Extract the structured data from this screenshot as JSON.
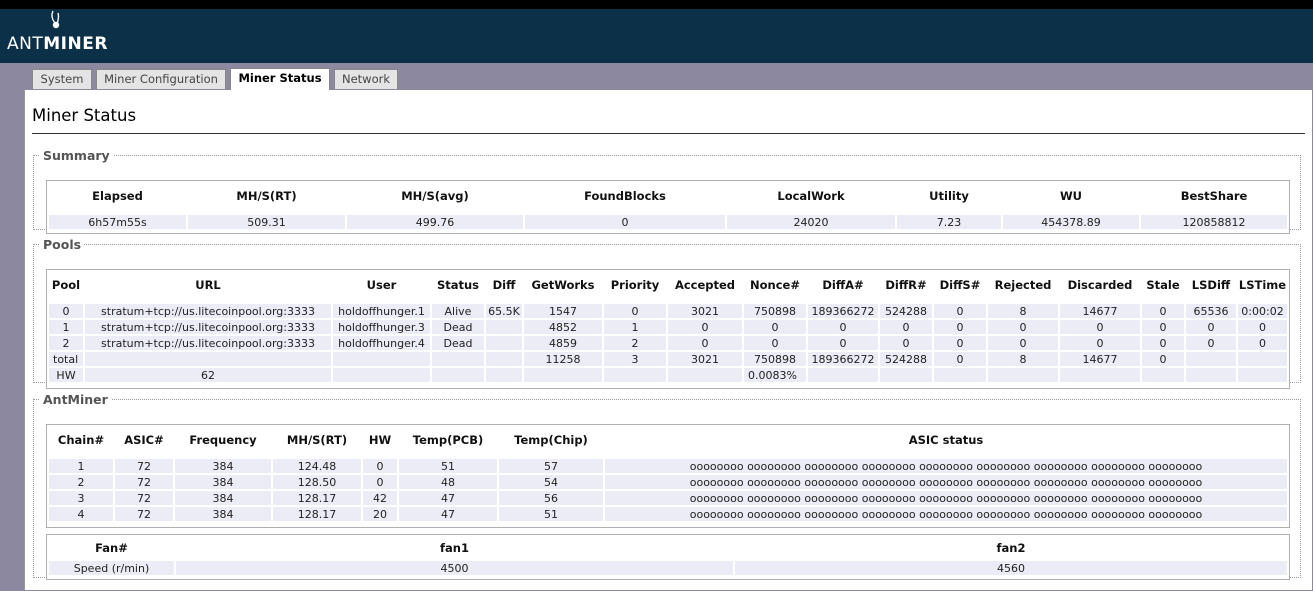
{
  "brand": {
    "prefix": "ANT",
    "suffix": "MINER"
  },
  "tabs": [
    {
      "label": "System"
    },
    {
      "label": "Miner Configuration"
    },
    {
      "label": "Miner Status"
    },
    {
      "label": "Network"
    }
  ],
  "page_title": "Miner Status",
  "summary": {
    "legend": "Summary",
    "headers": [
      "Elapsed",
      "MH/S(RT)",
      "MH/S(avg)",
      "FoundBlocks",
      "LocalWork",
      "Utility",
      "WU",
      "BestShare"
    ],
    "row": [
      "6h57m55s",
      "509.31",
      "499.76",
      "0",
      "24020",
      "7.23",
      "454378.89",
      "120858812"
    ]
  },
  "pools": {
    "legend": "Pools",
    "headers": [
      "Pool",
      "URL",
      "User",
      "Status",
      "Diff",
      "GetWorks",
      "Priority",
      "Accepted",
      "Nonce#",
      "DiffA#",
      "DiffR#",
      "DiffS#",
      "Rejected",
      "Discarded",
      "Stale",
      "LSDiff",
      "LSTime"
    ],
    "rows": [
      [
        "0",
        "stratum+tcp://us.litecoinpool.org:3333",
        "holdoffhunger.1",
        "Alive",
        "65.5K",
        "1547",
        "0",
        "3021",
        "750898",
        "189366272",
        "524288",
        "0",
        "8",
        "14677",
        "0",
        "65536",
        "0:00:02"
      ],
      [
        "1",
        "stratum+tcp://us.litecoinpool.org:3333",
        "holdoffhunger.3",
        "Dead",
        "",
        "4852",
        "1",
        "0",
        "0",
        "0",
        "0",
        "0",
        "0",
        "0",
        "0",
        "0",
        "0"
      ],
      [
        "2",
        "stratum+tcp://us.litecoinpool.org:3333",
        "holdoffhunger.4",
        "Dead",
        "",
        "4859",
        "2",
        "0",
        "0",
        "0",
        "0",
        "0",
        "0",
        "0",
        "0",
        "0",
        "0"
      ],
      [
        "total",
        "",
        "",
        "",
        "",
        "11258",
        "3",
        "3021",
        "750898",
        "189366272",
        "524288",
        "0",
        "8",
        "14677",
        "0",
        "",
        ""
      ]
    ],
    "hw_label": "HW",
    "hw_value": "62",
    "hw_rate": "0.0083%"
  },
  "antminer": {
    "legend": "AntMiner",
    "headers": [
      "Chain#",
      "ASIC#",
      "Frequency",
      "MH/S(RT)",
      "HW",
      "Temp(PCB)",
      "Temp(Chip)",
      "ASIC status"
    ],
    "rows": [
      [
        "1",
        "72",
        "384",
        "124.48",
        "0",
        "51",
        "57",
        "oooooooo oooooooo oooooooo oooooooo oooooooo oooooooo oooooooo oooooooo oooooooo"
      ],
      [
        "2",
        "72",
        "384",
        "128.50",
        "0",
        "48",
        "54",
        "oooooooo oooooooo oooooooo oooooooo oooooooo oooooooo oooooooo oooooooo oooooooo"
      ],
      [
        "3",
        "72",
        "384",
        "128.17",
        "42",
        "47",
        "56",
        "oooooooo oooooooo oooooooo oooooooo oooooooo oooooooo oooooooo oooooooo oooooooo"
      ],
      [
        "4",
        "72",
        "384",
        "128.17",
        "20",
        "47",
        "51",
        "oooooooo oooooooo oooooooo oooooooo oooooooo oooooooo oooooooo oooooooo oooooooo"
      ]
    ],
    "fan_headers": [
      "Fan#",
      "fan1",
      "fan2"
    ],
    "fan_row": [
      "Speed (r/min)",
      "4500",
      "4560"
    ]
  }
}
